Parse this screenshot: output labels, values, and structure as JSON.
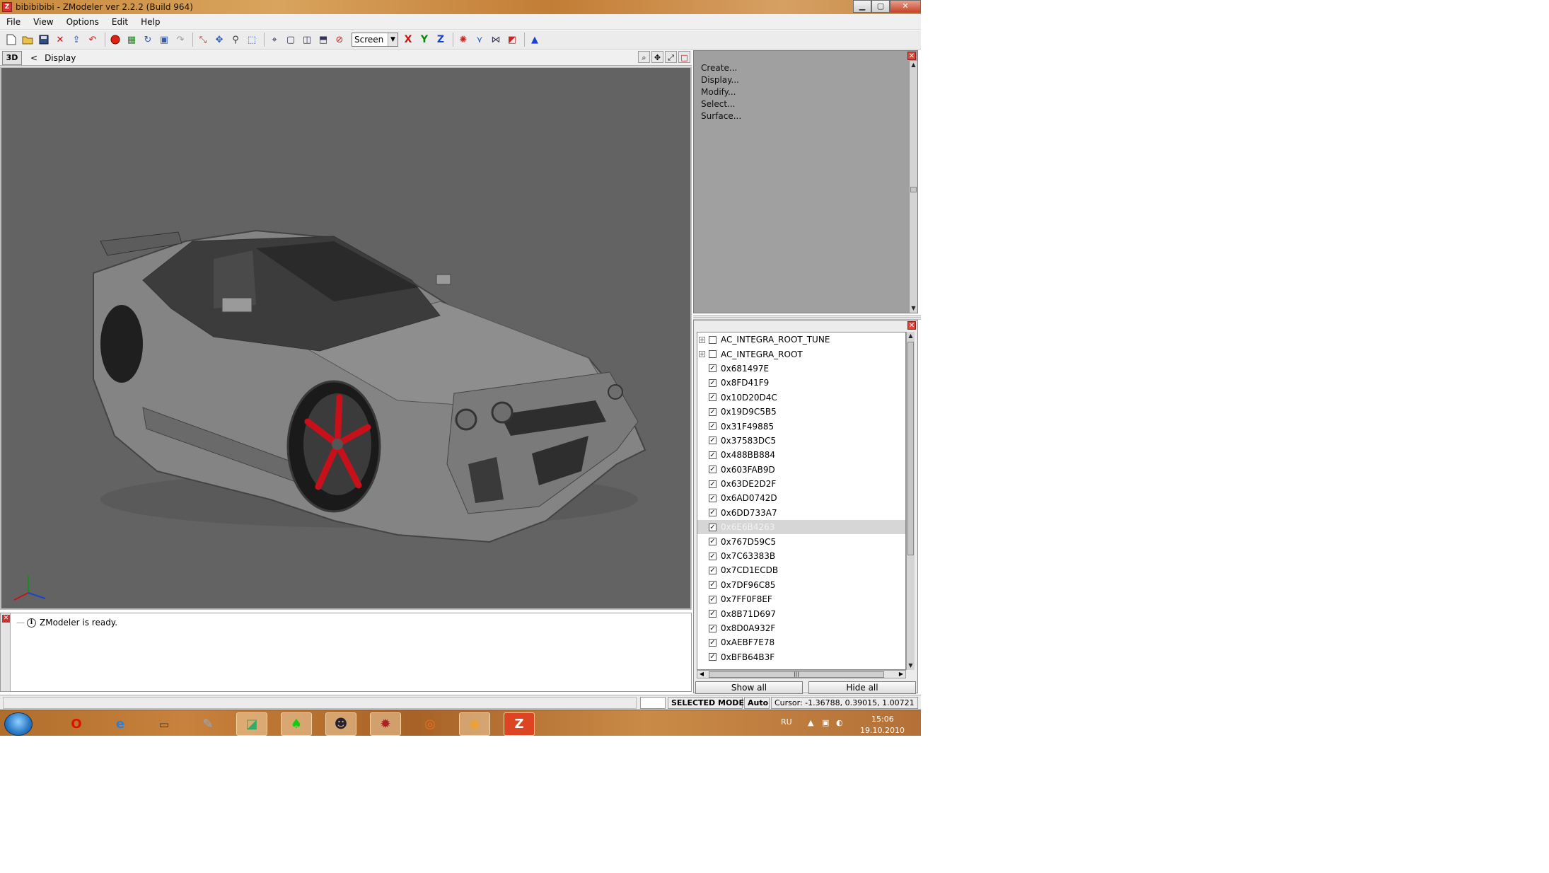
{
  "window": {
    "title": "bibibibibi - ZModeler ver 2.2.2 (Build 964)",
    "app_icon": "zmodeler-icon",
    "minimize": "▁",
    "maximize": "▢",
    "close": "✕"
  },
  "menu": [
    "File",
    "View",
    "Options",
    "Edit",
    "Help"
  ],
  "toolbar": {
    "icons": [
      "new-icon",
      "open-icon",
      "save-icon",
      "delete-icon",
      "import-icon",
      "undo-icon",
      "redo-icon",
      "record-icon",
      "export-icon",
      "refresh-icon",
      "help-icon",
      "select-icon",
      "move-icon",
      "rotate-icon",
      "scale-icon",
      "camera-icon",
      "zoom-icon",
      "box-icon",
      "cube-icon",
      "mirror-icon",
      "cancel-icon"
    ],
    "coord_system": "Screen",
    "axes": [
      "X",
      "Y",
      "Z"
    ],
    "axis_colors": {
      "X": "#cc1111",
      "Y": "#0a8a0a",
      "Z": "#1a44cc"
    }
  },
  "viewport": {
    "mode": "3D",
    "back": "<",
    "label": "Display",
    "background": "#636363",
    "wheel_color": "#c8101a"
  },
  "command_panel": {
    "items": [
      "Create...",
      "Display...",
      "Modify...",
      "Select...",
      "Surface..."
    ]
  },
  "hierarchy": {
    "rows": [
      {
        "label": "AC_INTEGRA_ROOT_TUNE",
        "checked": false,
        "expandable": true,
        "selected": false
      },
      {
        "label": "AC_INTEGRA_ROOT",
        "checked": false,
        "expandable": true,
        "selected": false
      },
      {
        "label": "0x681497E",
        "checked": true,
        "expandable": false,
        "selected": false
      },
      {
        "label": "0x8FD41F9",
        "checked": true,
        "expandable": false,
        "selected": false
      },
      {
        "label": "0x10D20D4C",
        "checked": true,
        "expandable": false,
        "selected": false
      },
      {
        "label": "0x19D9C5B5",
        "checked": true,
        "expandable": false,
        "selected": false
      },
      {
        "label": "0x31F49885",
        "checked": true,
        "expandable": false,
        "selected": false
      },
      {
        "label": "0x37583DC5",
        "checked": true,
        "expandable": false,
        "selected": false
      },
      {
        "label": "0x488BB884",
        "checked": true,
        "expandable": false,
        "selected": false
      },
      {
        "label": "0x603FAB9D",
        "checked": true,
        "expandable": false,
        "selected": false
      },
      {
        "label": "0x63DE2D2F",
        "checked": true,
        "expandable": false,
        "selected": false
      },
      {
        "label": "0x6AD0742D",
        "checked": true,
        "expandable": false,
        "selected": false
      },
      {
        "label": "0x6DD733A7",
        "checked": true,
        "expandable": false,
        "selected": false
      },
      {
        "label": "0x6E6B4263",
        "checked": true,
        "expandable": false,
        "selected": true
      },
      {
        "label": "0x767D59C5",
        "checked": true,
        "expandable": false,
        "selected": false
      },
      {
        "label": "0x7C63383B",
        "checked": true,
        "expandable": false,
        "selected": false
      },
      {
        "label": "0x7CD1ECDB",
        "checked": true,
        "expandable": false,
        "selected": false
      },
      {
        "label": "0x7DF96C85",
        "checked": true,
        "expandable": false,
        "selected": false
      },
      {
        "label": "0x7FF0F8EF",
        "checked": true,
        "expandable": false,
        "selected": false
      },
      {
        "label": "0x8B71D697",
        "checked": true,
        "expandable": false,
        "selected": false
      },
      {
        "label": "0x8D0A932F",
        "checked": true,
        "expandable": false,
        "selected": false
      },
      {
        "label": "0xAEBF7E78",
        "checked": true,
        "expandable": false,
        "selected": false
      },
      {
        "label": "0xBFB64B3F",
        "checked": true,
        "expandable": false,
        "selected": false
      }
    ],
    "show_all": "Show all",
    "hide_all": "Hide all"
  },
  "log": {
    "message": "ZModeler is ready."
  },
  "status": {
    "mode": "SELECTED MODE",
    "auto": "Auto",
    "cursor": "Cursor: -1.36788, 0.39015, 1.00721"
  },
  "taskbar": {
    "apps": [
      "opera-icon",
      "ie-icon",
      "computer-icon",
      "paint-icon",
      "media-icon",
      "game-icon",
      "soldier-icon",
      "explosion-icon",
      "spiral-icon",
      "burn-icon",
      "zmodeler-icon"
    ],
    "lang": "RU",
    "time": "15:06",
    "date": "19.10.2010"
  }
}
